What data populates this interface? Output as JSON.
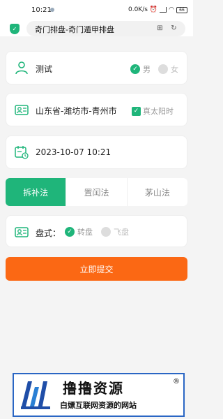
{
  "status_bar": {
    "time": "10:21",
    "net_speed": "0.0K/s",
    "battery": "66"
  },
  "header": {
    "title": "奇门排盘-奇门遁甲排盘",
    "shield_icon": "shield-icon",
    "bookmark_icon": "bookmark-icon",
    "refresh_icon": "refresh-icon"
  },
  "form": {
    "name": "测试",
    "gender": {
      "male": "男",
      "female": "女",
      "selected": "男"
    },
    "location": "山东省-潍坊市-青州市",
    "true_solar_time": {
      "label": "真太阳时",
      "checked": true
    },
    "datetime": "2023-10-07 10:21",
    "methods": [
      "拆补法",
      "置闰法",
      "茅山法"
    ],
    "active_method": "拆补法",
    "plate": {
      "label": "盘式：",
      "options": [
        "转盘",
        "飞盘"
      ],
      "selected": "转盘"
    },
    "submit_label": "立即提交"
  },
  "banner": {
    "title": "撸撸资源",
    "reg_mark": "®",
    "subtitle": "白嫖互联网资源的网站"
  },
  "colors": {
    "accent": "#1fb57a",
    "submit": "#fb6814"
  }
}
